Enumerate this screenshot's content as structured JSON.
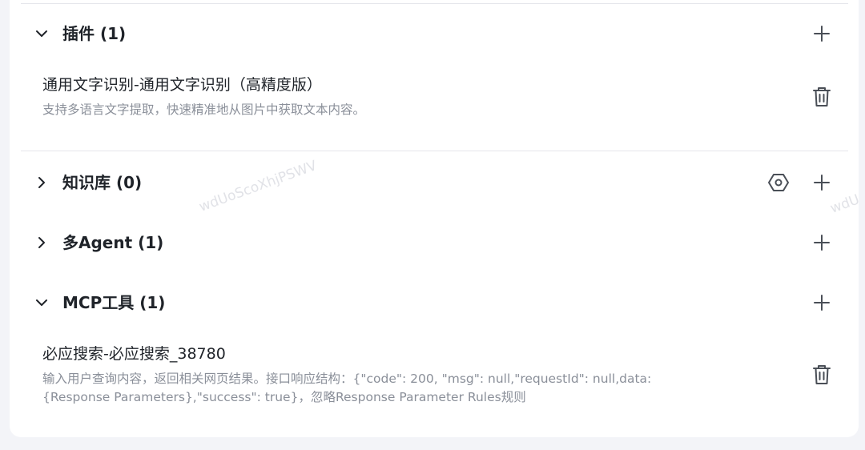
{
  "sections": {
    "plugins": {
      "title": "插件 (1)",
      "expanded": true,
      "items": [
        {
          "name": "通用文字识别-通用文字识别（高精度版）",
          "description": "支持多语言文字提取，快速精准地从图片中获取文本内容。"
        }
      ]
    },
    "knowledge": {
      "title": "知识库 (0)",
      "expanded": false
    },
    "multi_agent": {
      "title": "多Agent (1)",
      "expanded": false
    },
    "mcp_tools": {
      "title": "MCP工具 (1)",
      "expanded": true,
      "items": [
        {
          "name": "必应搜索-必应搜索_38780",
          "description_line1": "输入用户查询内容，返回相关网页结果。接口响应结构：{\"code\": 200, \"msg\": null,\"requestId\": null,data:",
          "description_line2": "{Response Parameters},\"success\": true}，忽略Response Parameter Rules规则"
        }
      ]
    }
  },
  "watermark": {
    "text": "wdUoScoXhjPSWV"
  },
  "icons": {
    "expanded": "chevron-down-icon",
    "collapsed": "chevron-right-icon",
    "add": "plus-icon",
    "delete": "trash-icon",
    "settings": "hexagon-settings-icon"
  },
  "colors": {
    "page_bg": "#f3f4f8",
    "panel_bg": "#ffffff",
    "text_primary": "#1f2329",
    "text_secondary": "#8a8f99",
    "divider": "#e5e6eb"
  }
}
